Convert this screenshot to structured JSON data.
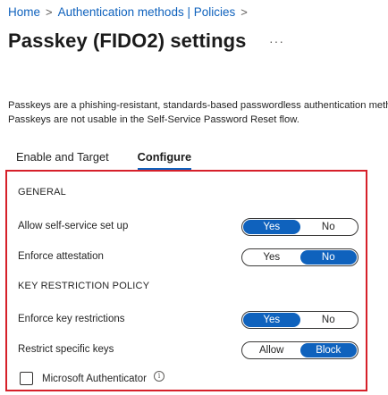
{
  "breadcrumb": {
    "items": [
      "Home",
      "Authentication methods | Policies"
    ],
    "separator": ">"
  },
  "header": {
    "title": "Passkey (FIDO2) settings",
    "more_label": "···"
  },
  "description": {
    "line1": "Passkeys are a phishing-resistant, standards-based passwordless authentication method. Passkeys",
    "line2": "Passkeys are not usable in the Self-Service Password Reset flow."
  },
  "tabs": [
    {
      "label": "Enable and Target",
      "active": false
    },
    {
      "label": "Configure",
      "active": true
    }
  ],
  "configure": {
    "general_heading": "GENERAL",
    "allow_self_service": {
      "label": "Allow self-service set up",
      "options": [
        "Yes",
        "No"
      ],
      "selected": "Yes"
    },
    "enforce_attestation": {
      "label": "Enforce attestation",
      "options": [
        "Yes",
        "No"
      ],
      "selected": "No"
    },
    "key_restriction_heading": "KEY RESTRICTION POLICY",
    "enforce_key_restrictions": {
      "label": "Enforce key restrictions",
      "options": [
        "Yes",
        "No"
      ],
      "selected": "Yes"
    },
    "restrict_specific_keys": {
      "label": "Restrict specific keys",
      "options": [
        "Allow",
        "Block"
      ],
      "selected": "Block"
    },
    "microsoft_authenticator": {
      "label": "Microsoft Authenticator",
      "checked": false,
      "info_icon": "info-icon"
    }
  },
  "colors": {
    "accent": "#0f62bd",
    "highlight_border": "#d6202a"
  }
}
